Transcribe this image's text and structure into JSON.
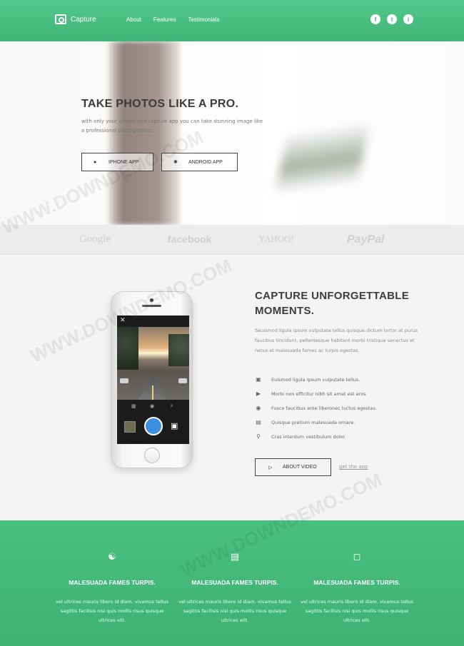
{
  "nav": {
    "brand": "Capture",
    "links": [
      "About",
      "Features",
      "Testimonials"
    ],
    "social": [
      {
        "icon": "facebook-icon",
        "glyph": "f"
      },
      {
        "icon": "twitter-icon",
        "glyph": "t"
      },
      {
        "icon": "instagram-icon",
        "glyph": "i"
      }
    ]
  },
  "hero": {
    "title": "TAKE PHOTOS LIKE A PRO.",
    "subtitle": "with only your iphone and capture app you can take stunning image like a professional photographer.",
    "buttons": [
      {
        "label": "IPHONE APP",
        "icon": "apple-icon"
      },
      {
        "label": "ANDROID APP",
        "icon": "android-icon"
      }
    ]
  },
  "brands": [
    "Google",
    "facebook",
    "YAHOO!",
    "PayPal"
  ],
  "feature": {
    "title": "CAPTURE UNFORGETTABLE MOMENTS.",
    "description": "Seuismod ligula ipsum vulputate tellus quisque dictum tortor at purus faucibus tincidunt, pellentesque habitant morbi tristique senectus et netus et malesuada fames ac turpis egestas.",
    "items": [
      {
        "icon": "camera-icon",
        "text": "Euismod ligula ipsum vulputate tellus."
      },
      {
        "icon": "video-camera-icon",
        "text": "Morbi non efficitur nibh sit amet est eros."
      },
      {
        "icon": "eye-icon",
        "text": "Fusce faucibus ante liberonec luctus egestas."
      },
      {
        "icon": "image-icon",
        "text": "Quisque pretium malesuada ornare."
      },
      {
        "icon": "location-pin-icon",
        "text": "Cras interdum vestibulum dolor."
      }
    ],
    "video_button": "ABOUT VIDEO",
    "get_app": "get the app"
  },
  "columns": [
    {
      "icon": "users-icon",
      "title": "MALESUADA FAMES TURPIS.",
      "text": "vel ultrices mauris libero id diam. vivamus tellus sagittis facilisis nisi quis mollis risus quisque ultrices elit."
    },
    {
      "icon": "picture-icon",
      "title": "MALESUADA FAMES TURPIS.",
      "text": "vel ultrices mauris libero id diam. vivamus tellus sagittis facilisis nisi quis mollis risus quisque ultrices elit."
    },
    {
      "icon": "inbox-icon",
      "title": "MALESUADA FAMES TURPIS.",
      "text": "vel ultrices mauris libero id diam. vivamus tellus sagittis facilisis nisi quis mollis risus quisque ultrices elit."
    }
  ],
  "watermark": "WWW.DOWNDEMO.COM",
  "colors": {
    "green": "#3fb676",
    "shutter": "#3a8fe0",
    "title": "#3b3b3b"
  }
}
